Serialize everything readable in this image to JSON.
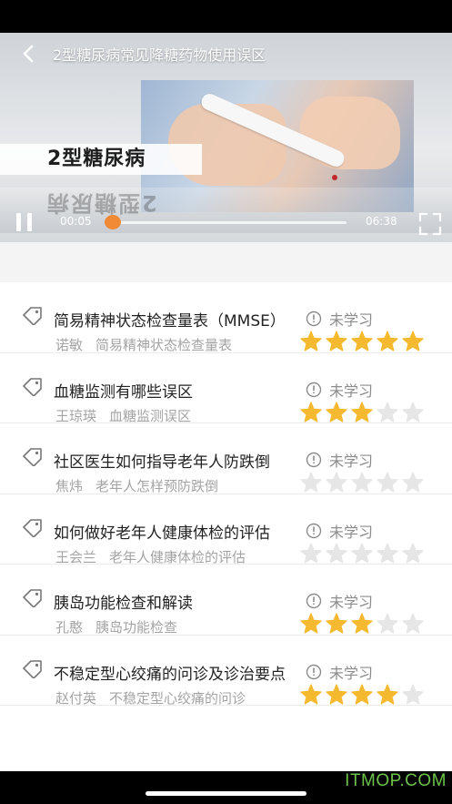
{
  "video": {
    "title": "2型糖尿病常见降糖药物使用误区",
    "banner_text": "2型糖尿病",
    "current_time": "00:05",
    "total_time": "06:38",
    "progress": 0.012
  },
  "courses": [
    {
      "title": "简易精神状态检查量表（MMSE）",
      "teacher": "诺敏",
      "subtitle": "简易精神状态检查量表",
      "status": "未学习",
      "rating": 5
    },
    {
      "title": "血糖监测有哪些误区",
      "teacher": "王琼瑛",
      "subtitle": "血糖监测误区",
      "status": "未学习",
      "rating": 3
    },
    {
      "title": "社区医生如何指导老年人防跌倒",
      "teacher": "焦炜",
      "subtitle": "老年人怎样预防跌倒",
      "status": "未学习",
      "rating": 0
    },
    {
      "title": "如何做好老年人健康体检的评估",
      "teacher": "王会兰",
      "subtitle": "老年人健康体检的评估",
      "status": "未学习",
      "rating": 0
    },
    {
      "title": "胰岛功能检查和解读",
      "teacher": "孔憨",
      "subtitle": "胰岛功能检查",
      "status": "未学习",
      "rating": 3
    },
    {
      "title": "不稳定型心绞痛的问诊及诊治要点",
      "teacher": "赵付英",
      "subtitle": "不稳定型心绞痛的问诊",
      "status": "未学习",
      "rating": 4
    }
  ],
  "colors": {
    "star_on": "#f5b92f",
    "star_off": "#e6e6e6",
    "progress": "#f08a35"
  },
  "watermark": "ITMOP.COM"
}
